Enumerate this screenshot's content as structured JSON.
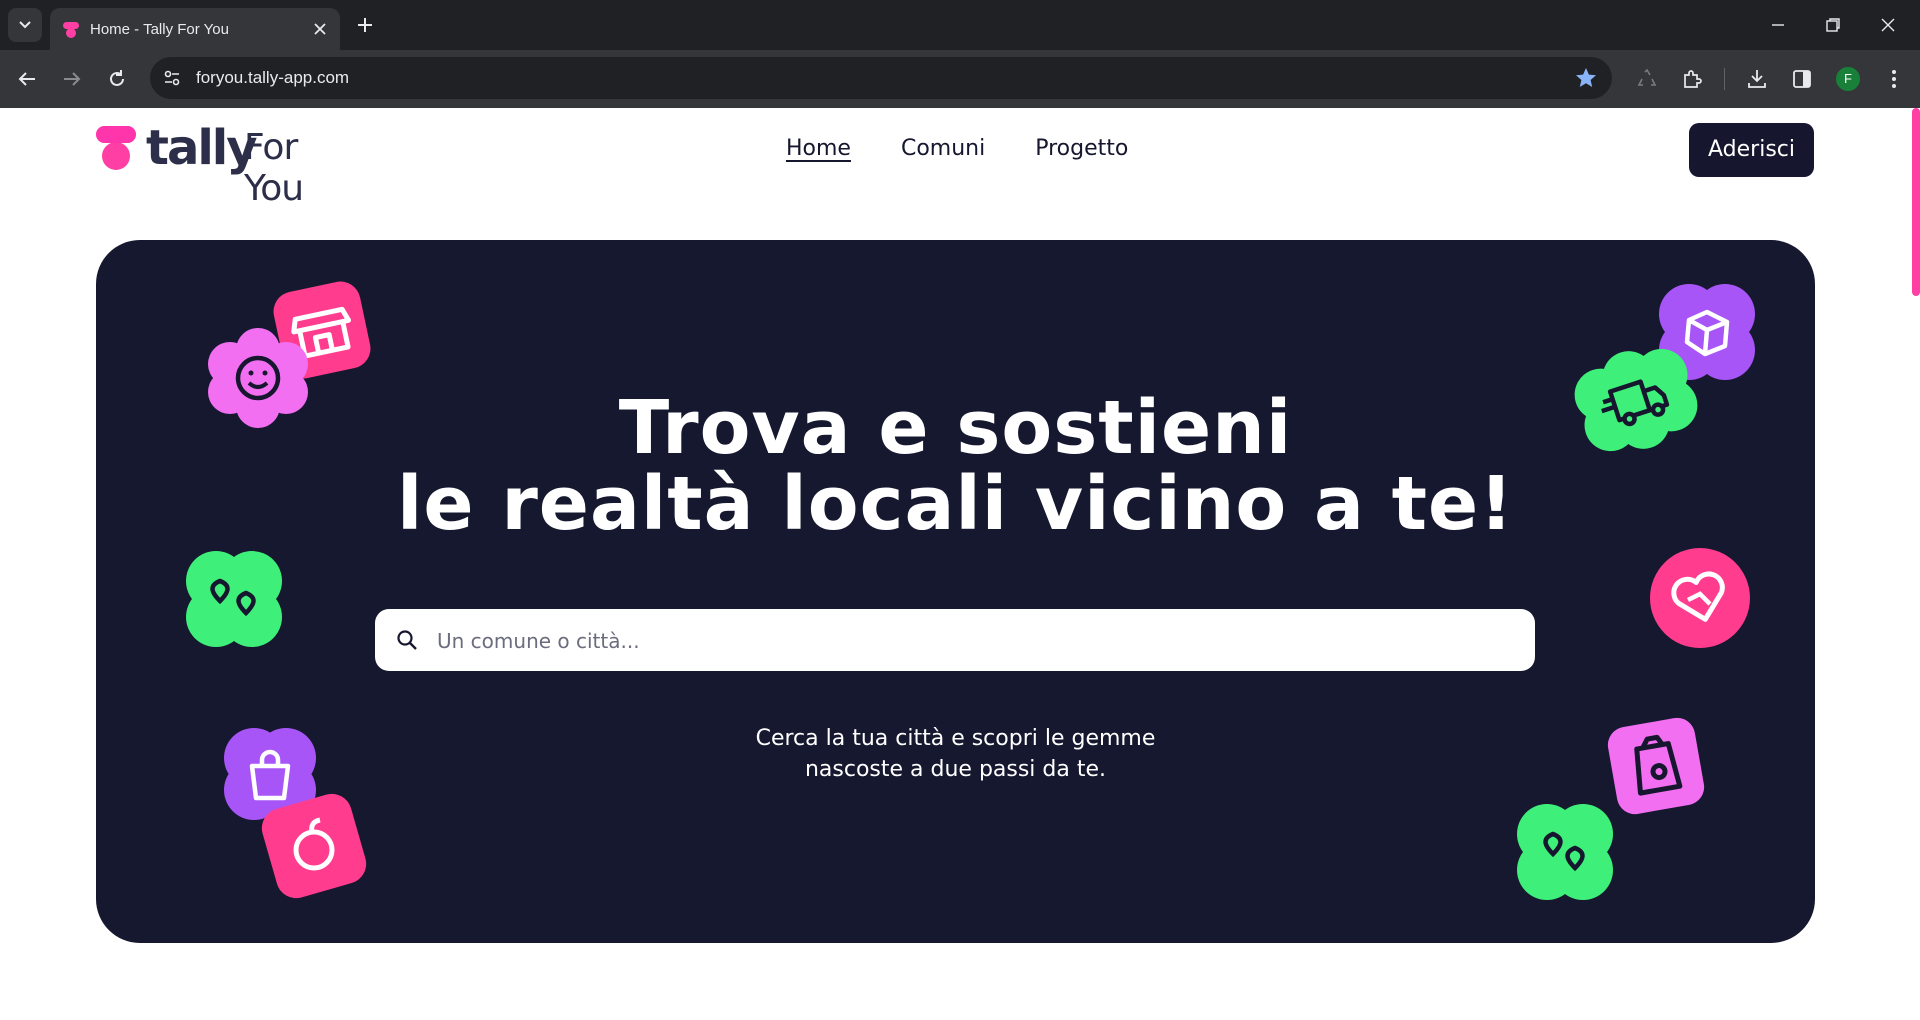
{
  "browser": {
    "tab_title": "Home - Tally For You",
    "url": "foryou.tally-app.com",
    "profile_initial": "F"
  },
  "site": {
    "logo": {
      "word1": "tally",
      "word2": "For You"
    },
    "nav": [
      {
        "label": "Home",
        "active": true
      },
      {
        "label": "Comuni",
        "active": false
      },
      {
        "label": "Progetto",
        "active": false
      }
    ],
    "cta_label": "Aderisci"
  },
  "hero": {
    "title_line1": "Trova e sostieni",
    "title_line2": "le realtà locali vicino a te!",
    "search_placeholder": "Un comune o città...",
    "subtitle_line1": "Cerca la tua città e scopri le gemme",
    "subtitle_line2": "nascoste a due passi da te."
  },
  "stickers": [
    {
      "icon": "store-icon",
      "color": "#ff3c8e"
    },
    {
      "icon": "smile-icon",
      "color": "#f26ff2"
    },
    {
      "icon": "location-pins-icon",
      "color": "#3ef07a"
    },
    {
      "icon": "shopping-bag-icon",
      "color": "#a855f7"
    },
    {
      "icon": "apple-icon",
      "color": "#ff3c8e"
    },
    {
      "icon": "box-icon",
      "color": "#a855f7"
    },
    {
      "icon": "truck-icon",
      "color": "#3ef07a"
    },
    {
      "icon": "heart-hand-icon",
      "color": "#ff3c8e"
    },
    {
      "icon": "package-bag-icon",
      "color": "#f26ff2"
    },
    {
      "icon": "location-pins-icon",
      "color": "#3ef07a"
    }
  ],
  "colors": {
    "hero_bg": "#16182f",
    "brand_pink": "#ff3fa4",
    "dark_navy": "#16172e"
  }
}
